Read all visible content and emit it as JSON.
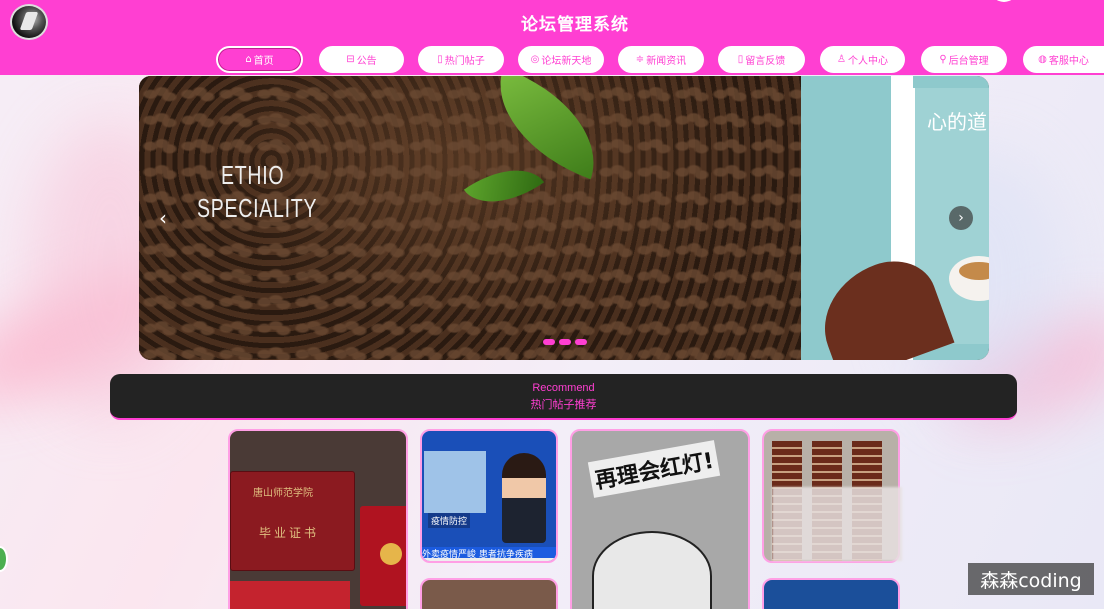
{
  "header": {
    "title": "论坛管理系统",
    "nav": [
      {
        "label": "首页",
        "icon": "home-icon",
        "glyph": "⌂",
        "active": true
      },
      {
        "label": "公告",
        "icon": "announcement-icon",
        "glyph": "⊟"
      },
      {
        "label": "热门帖子",
        "icon": "document-icon",
        "glyph": "▯"
      },
      {
        "label": "论坛新天地",
        "icon": "compass-icon",
        "glyph": "◎"
      },
      {
        "label": "新闻资讯",
        "icon": "sliders-icon",
        "glyph": "≑"
      },
      {
        "label": "留言反馈",
        "icon": "note-icon",
        "glyph": "▯"
      },
      {
        "label": "个人中心",
        "icon": "user-icon",
        "glyph": "♙"
      },
      {
        "label": "后台管理",
        "icon": "link-icon",
        "glyph": "⚲"
      },
      {
        "label": "客服中心",
        "icon": "chat-icon",
        "glyph": "◍"
      }
    ]
  },
  "carousel": {
    "slide1": {
      "line1": "ETHIO",
      "line2": "SPECIALITY"
    },
    "slide2": {
      "text": "心的道"
    },
    "prev": "‹",
    "next": "›"
  },
  "recommend": {
    "en": "Recommend",
    "cn": "热门帖子推荐"
  },
  "cards": {
    "diploma": {
      "school": "唐山师范学院",
      "title": "毕业证书"
    },
    "news": {
      "label": "疫情防控",
      "ticker": "外卖疫情严峻 患者抗争疾病"
    },
    "cartoon": {
      "text": "再理会红灯!"
    }
  },
  "watermark": "森森coding"
}
